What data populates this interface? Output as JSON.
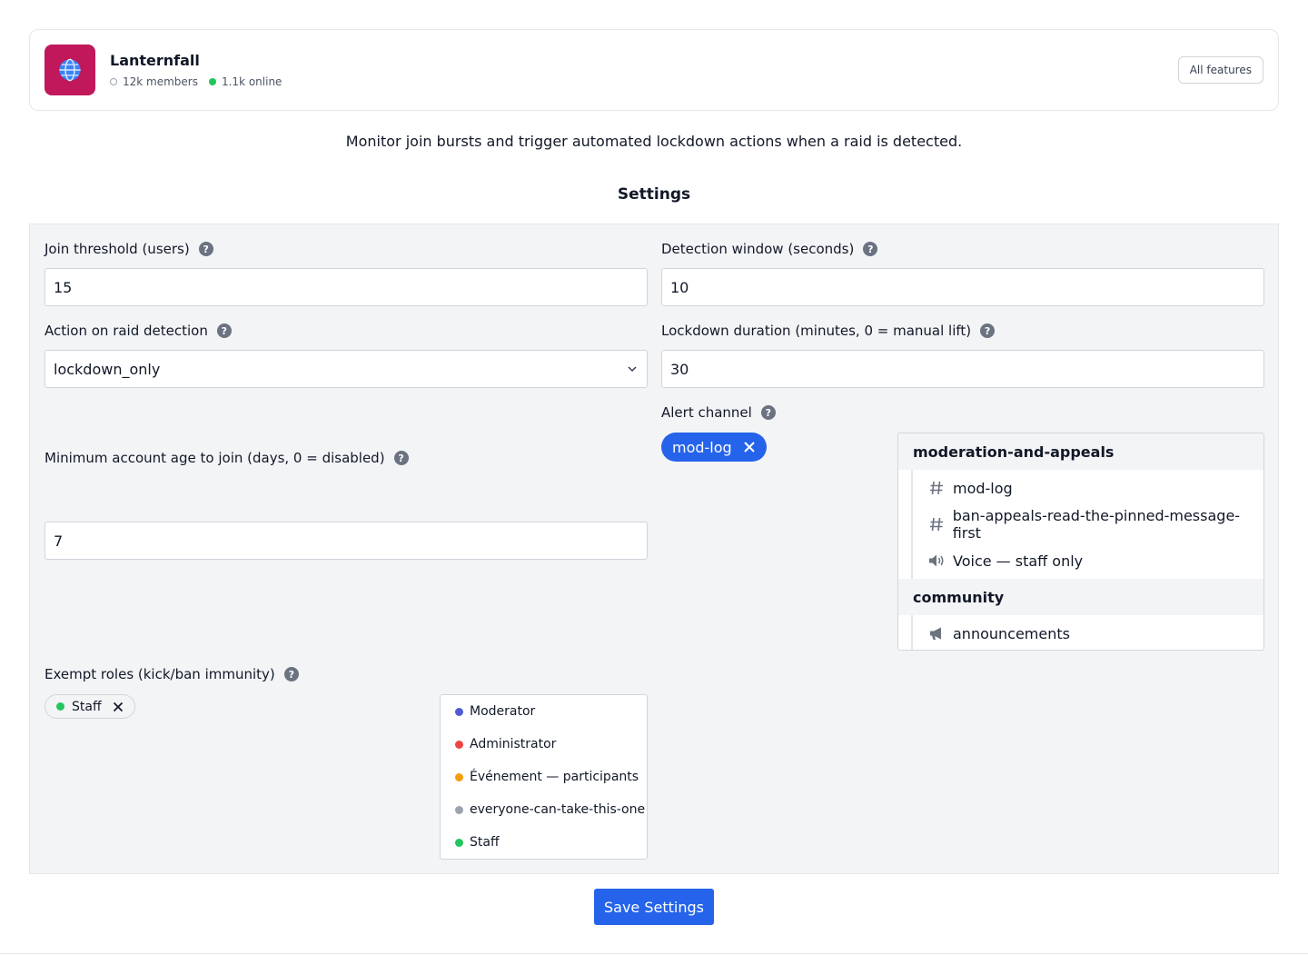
{
  "server": {
    "icon": "globe-icon",
    "icon_bg": "#c0185a",
    "name": "Lanternfall",
    "members": "12k members",
    "online": "1.1k online",
    "all_features_label": "All features"
  },
  "description": "Monitor join bursts and trigger automated lockdown actions when a raid is detected.",
  "section_title": "Settings",
  "fields": {
    "join_threshold": {
      "label": "Join threshold (users)",
      "value": "15"
    },
    "detection_window": {
      "label": "Detection window (seconds)",
      "value": "10"
    },
    "raid_action": {
      "label": "Action on raid detection",
      "value": "lockdown_only"
    },
    "lockdown_duration": {
      "label": "Lockdown duration (minutes, 0 = manual lift)",
      "value": "30"
    },
    "alert_channel": {
      "label": "Alert channel",
      "selected": "mod-log"
    },
    "min_account_age": {
      "label": "Minimum account age to join (days, 0 = disabled)",
      "value": "7"
    },
    "exempt_roles": {
      "label": "Exempt roles (kick/ban immunity)",
      "selected": "Staff"
    }
  },
  "help_glyph": "?",
  "channel_groups": [
    {
      "name": "moderation-and-appeals",
      "channels": [
        {
          "icon": "hash-icon",
          "name": "mod-log"
        },
        {
          "icon": "hash-icon",
          "name": "ban-appeals-read-the-pinned-message-first"
        },
        {
          "icon": "speaker-icon",
          "name": "Voice — staff only"
        }
      ]
    },
    {
      "name": "community",
      "channels": [
        {
          "icon": "megaphone-icon",
          "name": "announcements"
        }
      ]
    }
  ],
  "roles": [
    {
      "name": "Moderator",
      "color": "#4f5bd5"
    },
    {
      "name": "Administrator",
      "color": "#ef4444"
    },
    {
      "name": "Événement — participants",
      "color": "#f59e0b"
    },
    {
      "name": "everyone-can-take-this-one",
      "color": "#9ca3af"
    },
    {
      "name": "Staff",
      "color": "#22c55e"
    }
  ],
  "selected_role_color": "#22c55e",
  "accent_color": "#2563eb",
  "save_label": "Save Settings"
}
